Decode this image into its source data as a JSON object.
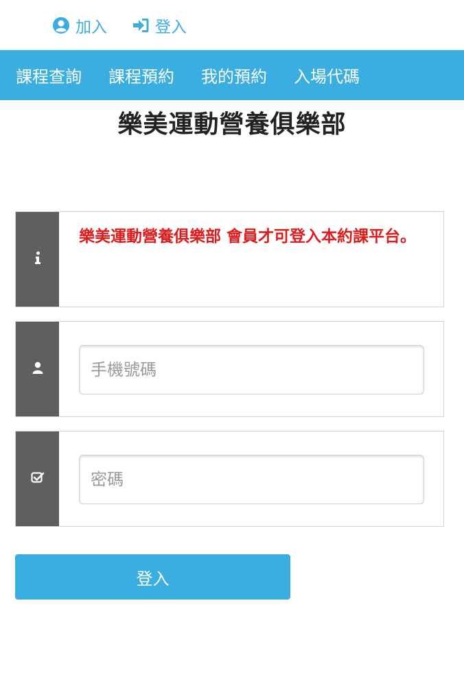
{
  "top_links": {
    "join_label": "加入",
    "login_label": "登入"
  },
  "nav": {
    "items": [
      {
        "label": "課程查詢"
      },
      {
        "label": "課程預約"
      },
      {
        "label": "我的預約"
      },
      {
        "label": "入場代碼"
      }
    ]
  },
  "page": {
    "title": "樂美運動營養俱樂部"
  },
  "notice": {
    "text": "樂美運動營養俱樂部 會員才可登入本約課平台。",
    "icon": "info-icon"
  },
  "form": {
    "phone_placeholder": "手機號碼",
    "phone_value": "",
    "password_placeholder": "密碼",
    "password_value": "",
    "submit_label": "登入"
  },
  "colors": {
    "accent": "#3aaee0",
    "side_panel": "#5f5f5f",
    "notice_text": "#e01b1b"
  }
}
